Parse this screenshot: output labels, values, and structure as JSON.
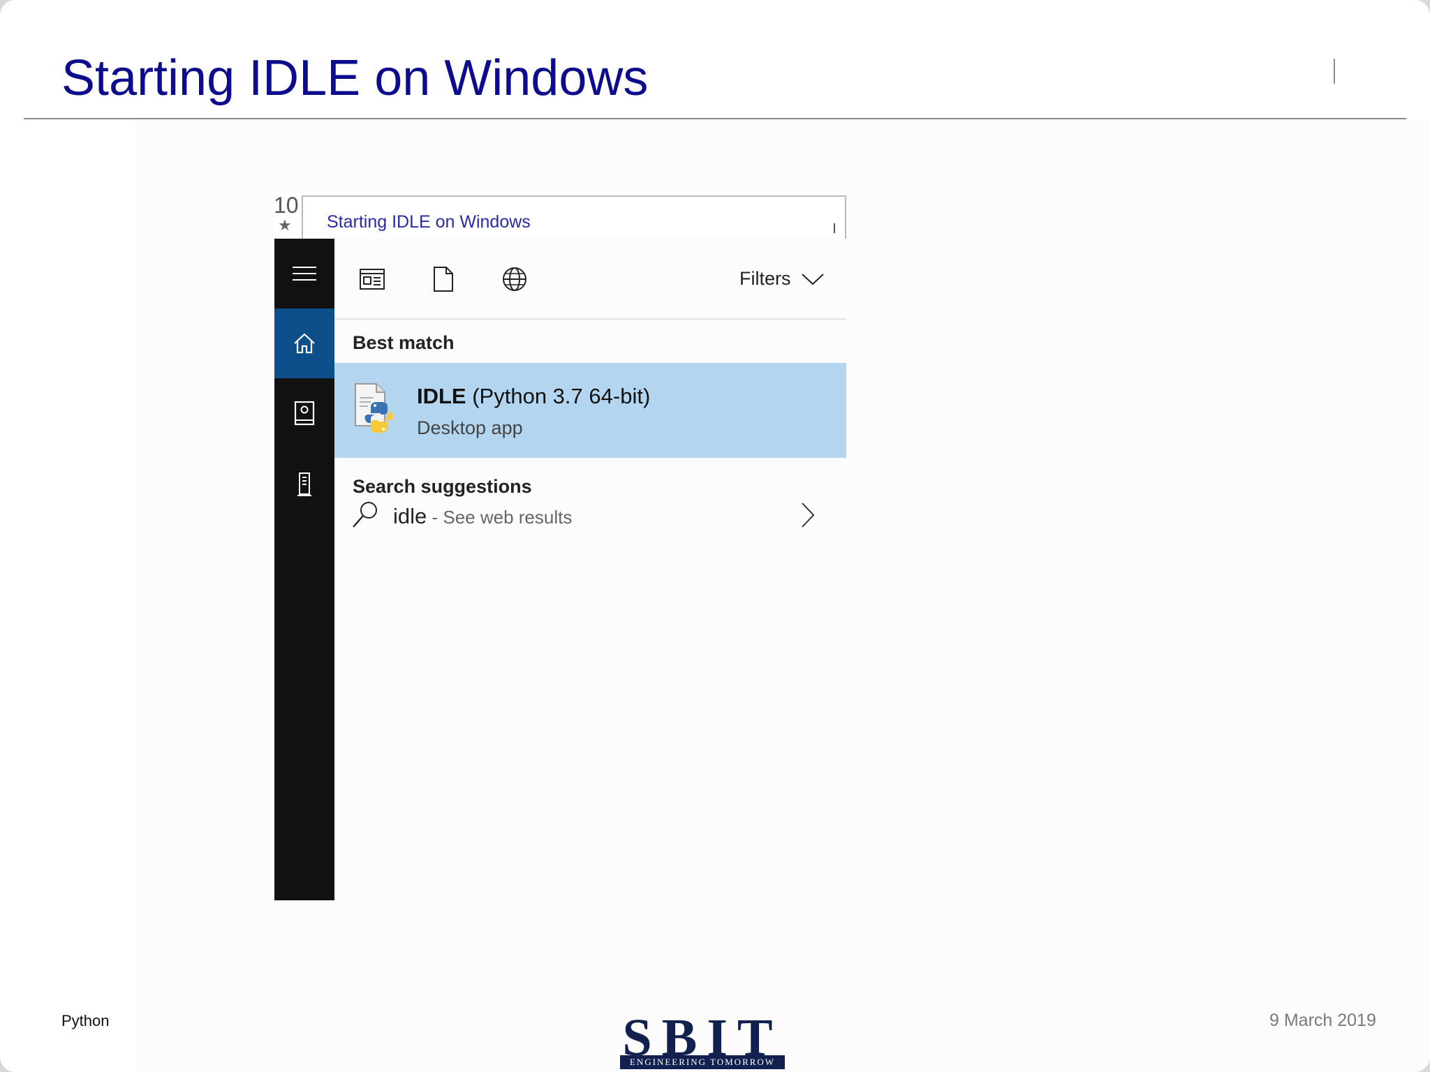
{
  "slide": {
    "title": "Starting IDLE on Windows",
    "footer_left": "Python",
    "footer_right": "9 March 2019",
    "logo_text": "SBIT",
    "logo_tagline": "ENGINEERING TOMORROW"
  },
  "screenshot": {
    "top_digits": "10",
    "thumbnail_title": "Starting IDLE on Windows",
    "toolbar": {
      "filters_label": "Filters"
    },
    "best_match_header": "Best match",
    "best_match": {
      "app_name_bold": "IDLE",
      "app_name_rest": " (Python 3.7 64-bit)",
      "app_kind": "Desktop app"
    },
    "suggestions_header": "Search suggestions",
    "suggestion": {
      "query": "idle",
      "hint": " - See web results"
    },
    "icons": [
      "hamburger-icon",
      "home-icon",
      "notebook-icon",
      "tower-icon",
      "apps-icon",
      "document-icon",
      "globe-icon",
      "chevron-down-icon",
      "search-icon",
      "chevron-right-icon"
    ],
    "colors": {
      "sidebar": "#121112",
      "active_nav": "#0d4f8b",
      "highlight": "#b4d5ef",
      "title_blue": "#0c0c8c"
    }
  }
}
